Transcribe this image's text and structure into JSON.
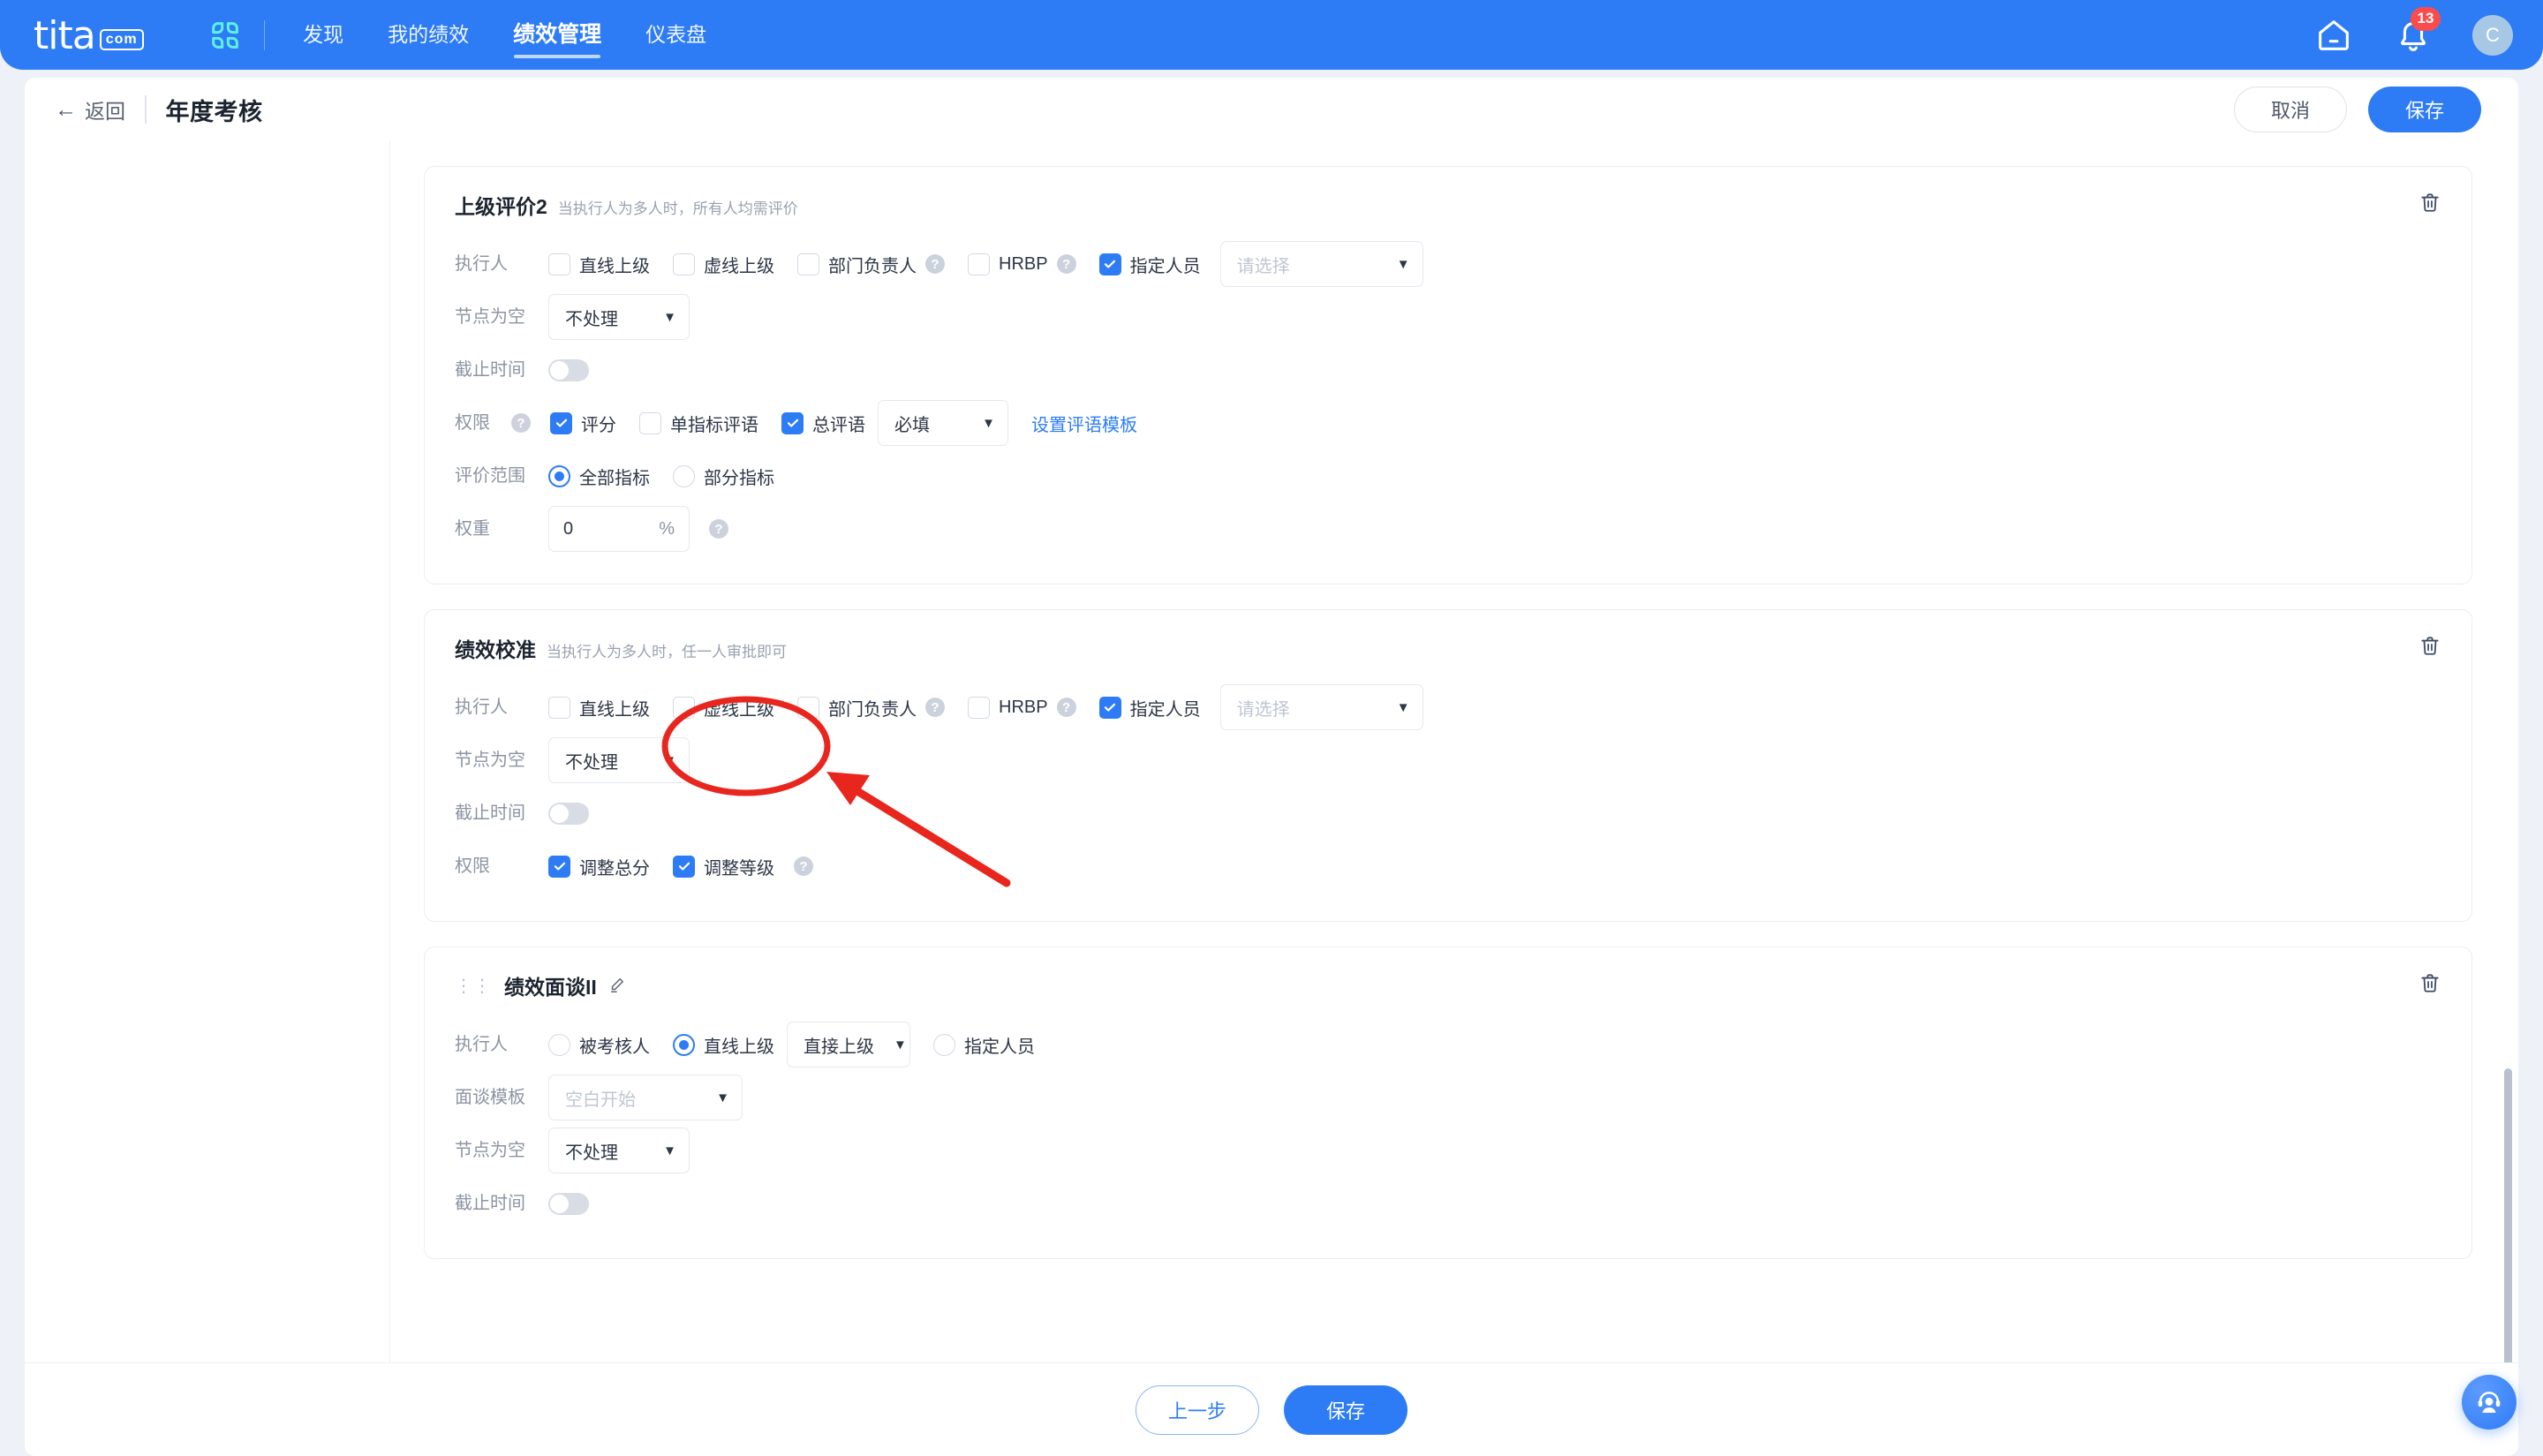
{
  "topnav": {
    "logo_text": "tita",
    "logo_suffix": ".com",
    "app_grid_icon": "app-grid-icon",
    "links": [
      {
        "label": "发现",
        "active": false
      },
      {
        "label": "我的绩效",
        "active": false
      },
      {
        "label": "绩效管理",
        "active": true
      },
      {
        "label": "仪表盘",
        "active": false
      }
    ],
    "home_icon": "home-icon",
    "bell_icon": "bell-icon",
    "notification_count": "13",
    "avatar_initial": "C"
  },
  "subheader": {
    "back_label": "返回",
    "back_icon": "arrow-left-icon",
    "title": "年度考核",
    "cancel_label": "取消",
    "save_label": "保存"
  },
  "cards": [
    {
      "title": "上级评价2",
      "desc": "当执行人为多人时，所有人均需评价",
      "delete_icon": "trash-icon",
      "executor": {
        "label": "执行人",
        "options": [
          {
            "label": "直线上级",
            "checked": false,
            "help": false
          },
          {
            "label": "虚线上级",
            "checked": false,
            "help": false
          },
          {
            "label": "部门负责人",
            "checked": false,
            "help": true
          },
          {
            "label": "HRBP",
            "checked": false,
            "help": true
          },
          {
            "label": "指定人员",
            "checked": true,
            "help": false
          }
        ],
        "person_select_placeholder": "请选择"
      },
      "empty_node": {
        "label": "节点为空",
        "value": "不处理"
      },
      "deadline": {
        "label": "截止时间",
        "enabled": false
      },
      "permission": {
        "label": "权限",
        "help": true,
        "options": [
          {
            "label": "评分",
            "checked": true
          },
          {
            "label": "单指标评语",
            "checked": false
          },
          {
            "label": "总评语",
            "checked": true
          }
        ],
        "required_select": "必填",
        "template_link": "设置评语模板"
      },
      "scope": {
        "label": "评价范围",
        "options": [
          {
            "label": "全部指标",
            "selected": true
          },
          {
            "label": "部分指标",
            "selected": false
          }
        ]
      },
      "weight": {
        "label": "权重",
        "value": "0",
        "unit": "%",
        "help": true
      }
    },
    {
      "title": "绩效校准",
      "desc": "当执行人为多人时，任一人审批即可",
      "delete_icon": "trash-icon",
      "executor": {
        "label": "执行人",
        "options": [
          {
            "label": "直线上级",
            "checked": false,
            "help": false
          },
          {
            "label": "虚线上级",
            "checked": false,
            "help": false
          },
          {
            "label": "部门负责人",
            "checked": false,
            "help": true
          },
          {
            "label": "HRBP",
            "checked": false,
            "help": true
          },
          {
            "label": "指定人员",
            "checked": true,
            "help": false
          }
        ],
        "person_select_placeholder": "请选择"
      },
      "empty_node": {
        "label": "节点为空",
        "value": "不处理"
      },
      "deadline": {
        "label": "截止时间",
        "enabled": false
      },
      "permission": {
        "label": "权限",
        "help": false,
        "options": [
          {
            "label": "调整总分",
            "checked": true
          },
          {
            "label": "调整等级",
            "checked": true,
            "help": true
          }
        ]
      }
    },
    {
      "title": "绩效面谈II",
      "desc": "",
      "drag_handle_icon": "drag-handle-icon",
      "edit_icon": "pencil-icon",
      "delete_icon": "trash-icon",
      "executor": {
        "label": "执行人",
        "options": [
          {
            "label": "被考核人",
            "selected": false
          },
          {
            "label": "直线上级",
            "selected": true
          },
          {
            "label": "指定人员",
            "selected": false
          }
        ],
        "level_select": "直接上级"
      },
      "interview_template": {
        "label": "面谈模板",
        "placeholder": "空白开始"
      },
      "empty_node": {
        "label": "节点为空",
        "value": "不处理"
      },
      "deadline": {
        "label": "截止时间",
        "enabled": false
      }
    }
  ],
  "bottombar": {
    "prev_label": "上一步",
    "save_label": "保存"
  },
  "support_button": {
    "icon": "headset-support-icon"
  },
  "annotation": {
    "ellipse_color": "#e8261e",
    "arrow_color": "#e8261e",
    "target_label": "虚线上级"
  },
  "colors": {
    "brand_blue": "#2d7cf6",
    "badge_red": "#fb4b4b",
    "page_bg": "#eef1f8"
  }
}
